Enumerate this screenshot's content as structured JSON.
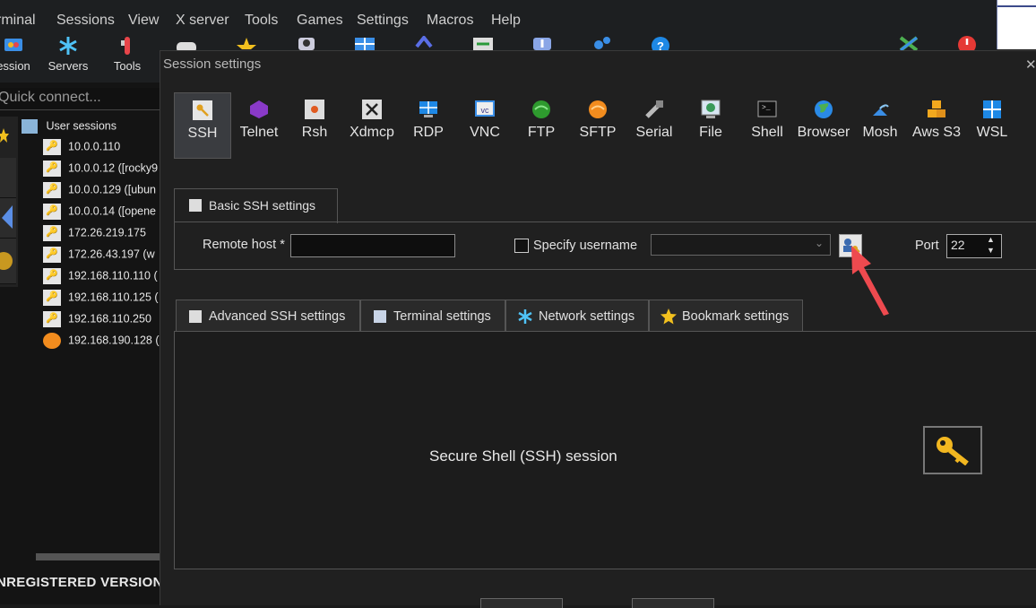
{
  "menu": [
    "rminal",
    "Sessions",
    "View",
    "X server",
    "Tools",
    "Games",
    "Settings",
    "Macros",
    "Help"
  ],
  "toolbar": {
    "session_label": "ession",
    "servers_label": "Servers",
    "tools_label": "Tools"
  },
  "quick_connect": {
    "placeholder": "Quick connect..."
  },
  "sidebar": {
    "root_label": "User sessions",
    "items": [
      "10.0.0.110",
      "10.0.0.12 ([rocky9",
      "10.0.0.129 ([ubun",
      "10.0.0.14 ([opene",
      "172.26.219.175",
      "172.26.43.197 (w",
      "192.168.110.110 (",
      "192.168.110.125 (",
      "192.168.110.250",
      "192.168.190.128 ("
    ],
    "footer": "NREGISTERED VERSION"
  },
  "dialog": {
    "title": "Session settings",
    "session_types": [
      "SSH",
      "Telnet",
      "Rsh",
      "Xdmcp",
      "RDP",
      "VNC",
      "FTP",
      "SFTP",
      "Serial",
      "File",
      "Shell",
      "Browser",
      "Mosh",
      "Aws S3",
      "WSL"
    ],
    "basic_tab": "Basic SSH settings",
    "remote_host_label": "Remote host *",
    "remote_host_value": "",
    "specify_username_label": "Specify username",
    "username_value": "",
    "port_label": "Port",
    "port_value": "22",
    "lower_tabs": [
      "Advanced SSH settings",
      "Terminal settings",
      "Network settings",
      "Bookmark settings"
    ],
    "description": "Secure Shell (SSH) session"
  },
  "colors": {
    "accent_arrow": "#e8454a",
    "key_gold": "#f2b720"
  }
}
